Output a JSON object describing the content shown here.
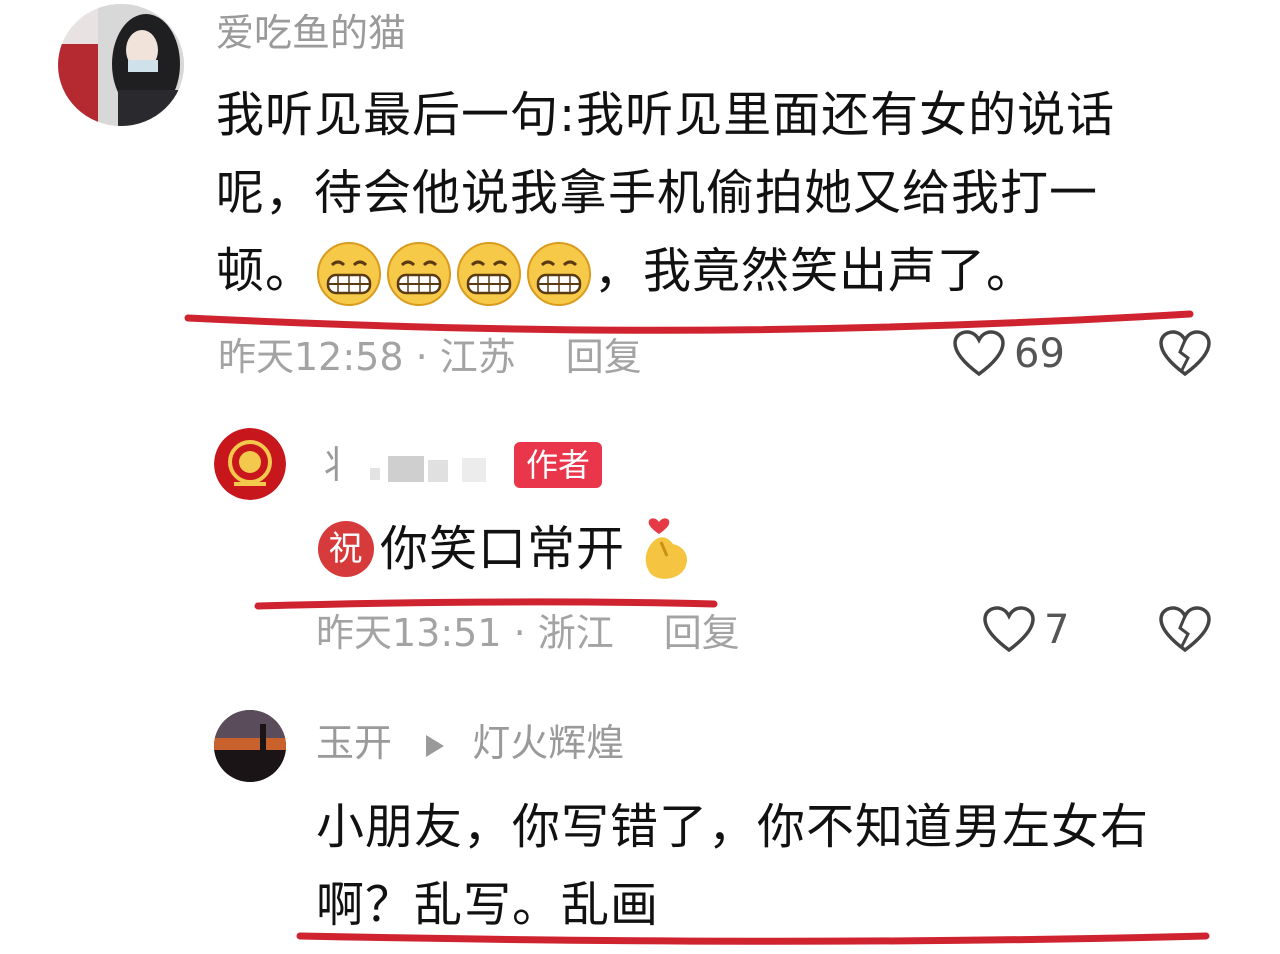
{
  "comments": [
    {
      "username": "爱吃鱼的猫",
      "line1": "我听见最后一句:我听见里面还有女的说话",
      "line2": "呢，待会他说我拿手机偷拍她又给我打一",
      "line3_start": "顿。",
      "line3_end": "，我竟然笑出声了。",
      "emoji_count": 4,
      "emoji_name": "grin-emoji",
      "time_location": "昨天12:58 · 江苏",
      "reply_label": "回复",
      "likes": "69"
    },
    {
      "username_partial": "丬",
      "badge": "作者",
      "badge_color": "#e9364a",
      "text": "你笑口常开",
      "bless_char": "祝",
      "time_location": "昨天13:51 · 浙江",
      "reply_label": "回复",
      "likes": "7"
    },
    {
      "username": "玉开",
      "reply_to": "灯火辉煌",
      "line1": "小朋友，你写错了，你不知道男左女右",
      "line2": "啊？乱写。乱画"
    }
  ],
  "colors": {
    "underline": "#cf2330",
    "meta": "#a3a3a3",
    "accent": "#e9364a"
  }
}
